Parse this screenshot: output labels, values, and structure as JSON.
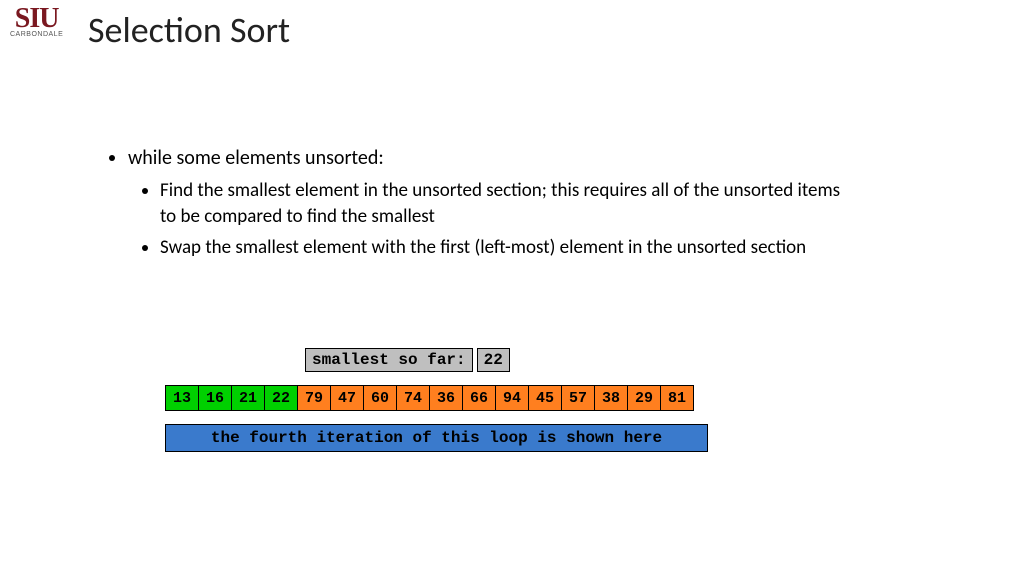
{
  "logo": {
    "main": "SIU",
    "sub": "CARBONDALE"
  },
  "title": "Selection Sort",
  "bullet_main": "while some elements unsorted:",
  "bullet_sub_1": "Find the smallest element in the unsorted section; this requires all of the unsorted items to be compared to find the smallest",
  "bullet_sub_2": "Swap the smallest element with the first (left-most) element in the unsorted section",
  "smallest_label": "smallest so far:",
  "smallest_value": "22",
  "array": {
    "sorted": [
      "13",
      "16",
      "21",
      "22"
    ],
    "unsorted": [
      "79",
      "47",
      "60",
      "74",
      "36",
      "66",
      "94",
      "45",
      "57",
      "38",
      "29",
      "81"
    ]
  },
  "caption": "the fourth iteration of this loop is shown here"
}
